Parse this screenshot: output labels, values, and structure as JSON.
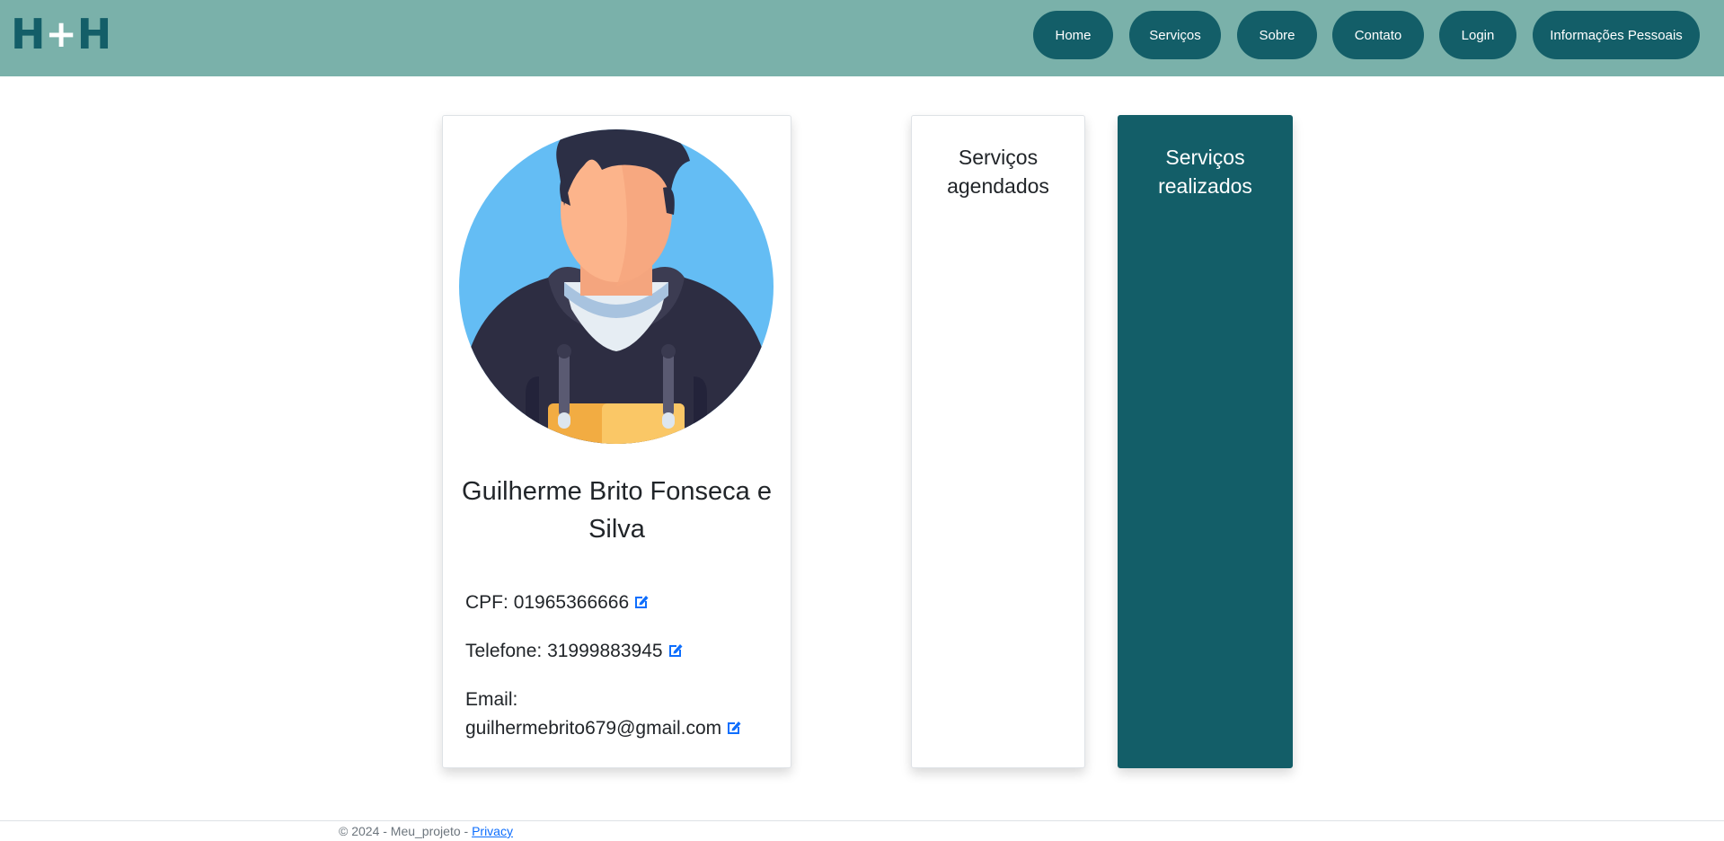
{
  "brand": {
    "letter_left": "H",
    "plus": "+",
    "letter_right": "H"
  },
  "nav": {
    "home": "Home",
    "servicos": "Serviços",
    "sobre": "Sobre",
    "contato": "Contato",
    "login": "Login",
    "info": "Informações Pessoais"
  },
  "profile": {
    "avatar_icon": "user-avatar-illustration",
    "name": "Guilherme Brito Fonseca e Silva",
    "cpf_label": "CPF:",
    "cpf_value": "01965366666",
    "telefone_label": "Telefone:",
    "telefone_value": "31999883945",
    "email_label": "Email:",
    "email_value": "guilhermebrito679@gmail.com",
    "edit_icon": "edit-icon"
  },
  "panels": {
    "agendados_title_line1": "Serviços",
    "agendados_title_line2": "agendados",
    "realizados_title_line1": "Serviços",
    "realizados_title_line2": "realizados"
  },
  "footer": {
    "copyright": "© 2024 - Meu_projeto - ",
    "privacy": "Privacy"
  },
  "colors": {
    "navbar": "#7ab1aa",
    "primary": "#135e68",
    "link": "#0d6efd"
  }
}
